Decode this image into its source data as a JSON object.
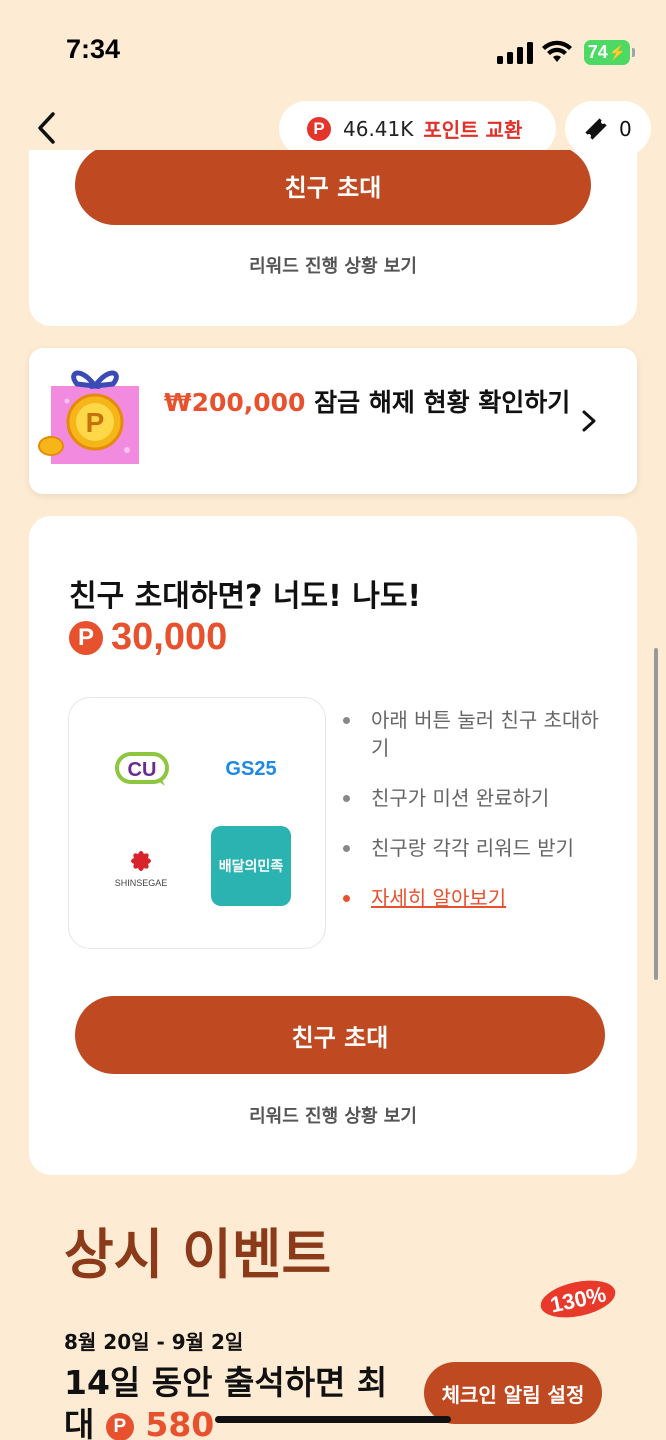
{
  "status": {
    "time": "7:34",
    "battery": "74"
  },
  "header": {
    "points_badge": "P",
    "points_value": "46.41K",
    "points_exchange": "포인트 교환",
    "ticket_count": "0"
  },
  "top_card": {
    "invite_button": "친구 초대",
    "progress_link": "리워드 진행 상황 보기"
  },
  "unlock": {
    "amount": "₩200,000",
    "text": " 잠금 해제 현황 확인하기"
  },
  "invite": {
    "title": "친구 초대하면? 너도! 나도!",
    "reward_badge": "P",
    "reward_amount": "30,000",
    "brands": {
      "cu": "CU",
      "gs25": "GS25",
      "shinsegae": "SHINSEGAE",
      "baemin": "배달의민족"
    },
    "steps": [
      "아래 버튼 눌러 친구 초대하기",
      "친구가 미션 완료하기",
      "친구랑 각각 리워드 받기"
    ],
    "learn_more": "자세히 알아보기",
    "invite_button": "친구 초대",
    "progress_link": "리워드 진행 상황 보기"
  },
  "events": {
    "section_title": "상시 이벤트",
    "badge": "130%",
    "date": "8월 20일 - 9월 2일",
    "title_text": "14일 동안 출석하면 최대 ",
    "title_badge": "P",
    "title_amount": "580",
    "checkin_button": "체크인 알림 설정"
  },
  "colors": {
    "accent": "#BF4A22",
    "reward": "#E8512E",
    "background": "#FDEBD3",
    "section_title": "#8B3A1A"
  }
}
